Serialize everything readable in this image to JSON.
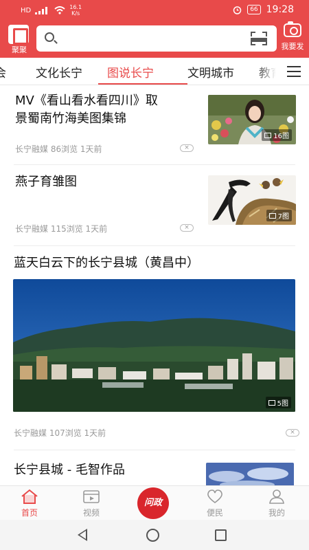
{
  "status_bar": {
    "network": "HD",
    "speed_value": "16.1",
    "speed_unit": "K/s",
    "battery": "66",
    "time": "19:28"
  },
  "header": {
    "logo_label": "聚聚",
    "search_placeholder": "",
    "publish_label": "我要发"
  },
  "tabs": {
    "items": [
      "会",
      "文化长宁",
      "图说长宁",
      "文明城市",
      "教育"
    ],
    "active_index": 2
  },
  "feed": {
    "items": [
      {
        "title_line1": "MV《看山看水看四川》取",
        "title_line2": "景蜀南竹海美图集锦",
        "meta": "长宁融媒 86浏览 1天前",
        "image_count": "16图"
      },
      {
        "title": "燕子育雏图",
        "meta": "长宁融媒 115浏览 1天前",
        "image_count": "7图"
      },
      {
        "title": "蓝天白云下的长宁县城（黄昌中）",
        "meta": "长宁融媒 107浏览 1天前",
        "image_count": "5图"
      },
      {
        "title": "长宁县城 - 毛智作品"
      }
    ],
    "close_label": "×"
  },
  "bottom_nav": {
    "items": [
      {
        "label": "首页",
        "icon": "home-icon",
        "active": true
      },
      {
        "label": "视频",
        "icon": "video-icon",
        "active": false
      },
      {
        "label": "问政",
        "icon": "wenzheng-logo",
        "active": false
      },
      {
        "label": "便民",
        "icon": "heart-icon",
        "active": false
      },
      {
        "label": "我的",
        "icon": "user-icon",
        "active": false
      }
    ]
  },
  "colors": {
    "brand_red": "#e84a4a",
    "wenzheng_red": "#d9262c"
  }
}
